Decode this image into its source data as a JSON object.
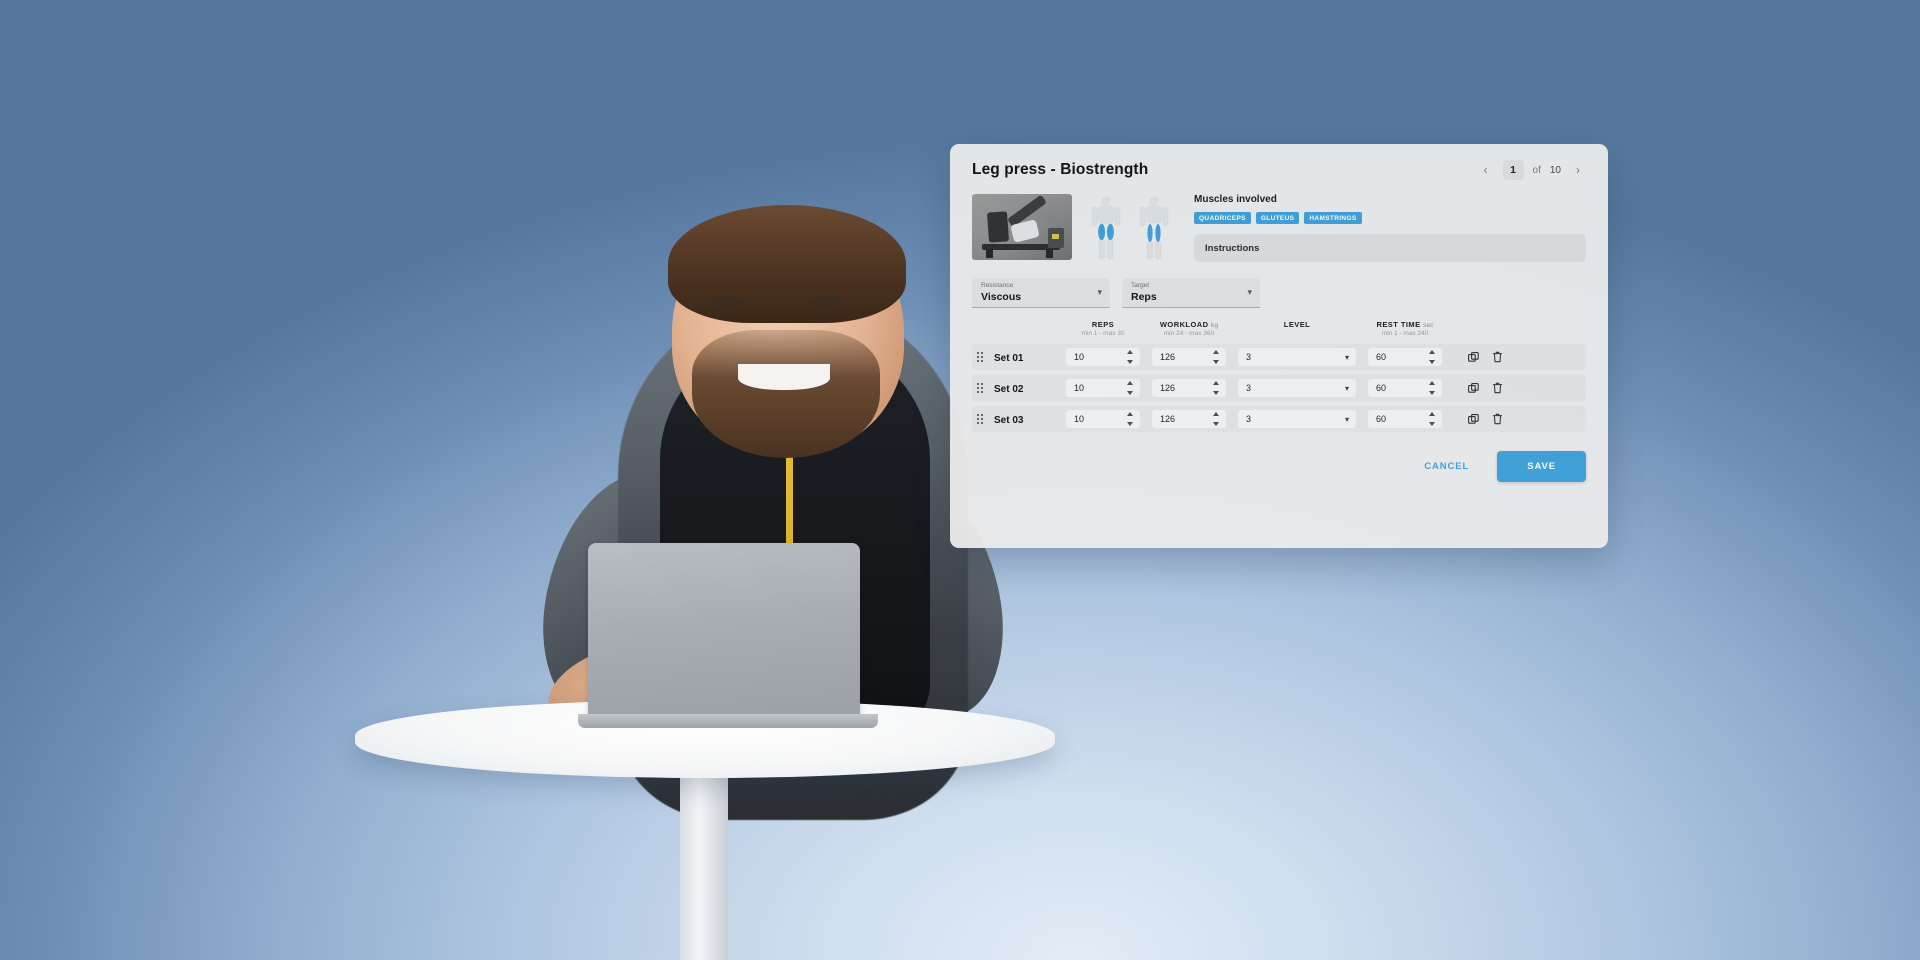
{
  "background": {
    "top_color": "#4D7099",
    "bottom_color": "#D3E0EF"
  },
  "panel": {
    "title": "Leg press - Biostrength",
    "accent_color": "#3FA0D9",
    "surface_color": "#EAEAEA",
    "pager": {
      "prev_icon": "chevron-left-icon",
      "next_icon": "chevron-right-icon",
      "current": "1",
      "of_label": "of",
      "total": "10"
    },
    "media": {
      "machine_thumbnail_alt": "leg-press-machine-photo",
      "body_front_alt": "body-front-diagram",
      "body_back_alt": "body-back-diagram"
    },
    "muscles": {
      "heading": "Muscles involved",
      "tags": [
        "QUADRICEPS",
        "GLUTEUS",
        "HAMSTRINGS"
      ]
    },
    "instructions": {
      "label": "Instructions"
    },
    "selects": [
      {
        "label": "Resistance",
        "value": "Viscous",
        "chevron": "chevron-down-icon"
      },
      {
        "label": "Target",
        "value": "Reps",
        "chevron": "chevron-down-icon"
      }
    ],
    "table": {
      "headers": {
        "reps": {
          "main": "REPS",
          "unit": "",
          "sub": "min 1 - max 30"
        },
        "load": {
          "main": "WORKLOAD",
          "unit": "kg",
          "sub": "min 24 - max 360"
        },
        "level": {
          "main": "LEVEL",
          "unit": "",
          "sub": ""
        },
        "rest": {
          "main": "REST TIME",
          "unit": "sec",
          "sub": "min 1 - max 240"
        }
      },
      "rows": [
        {
          "name": "Set 01",
          "reps": "10",
          "workload": "126",
          "level": "3",
          "rest": "60"
        },
        {
          "name": "Set 02",
          "reps": "10",
          "workload": "126",
          "level": "3",
          "rest": "60"
        },
        {
          "name": "Set 03",
          "reps": "10",
          "workload": "126",
          "level": "3",
          "rest": "60"
        }
      ],
      "row_icons": {
        "drag": "drag-handle-icon",
        "duplicate": "duplicate-icon",
        "delete": "trash-icon"
      }
    },
    "footer": {
      "cancel_label": "CANCEL",
      "save_label": "SAVE"
    }
  }
}
